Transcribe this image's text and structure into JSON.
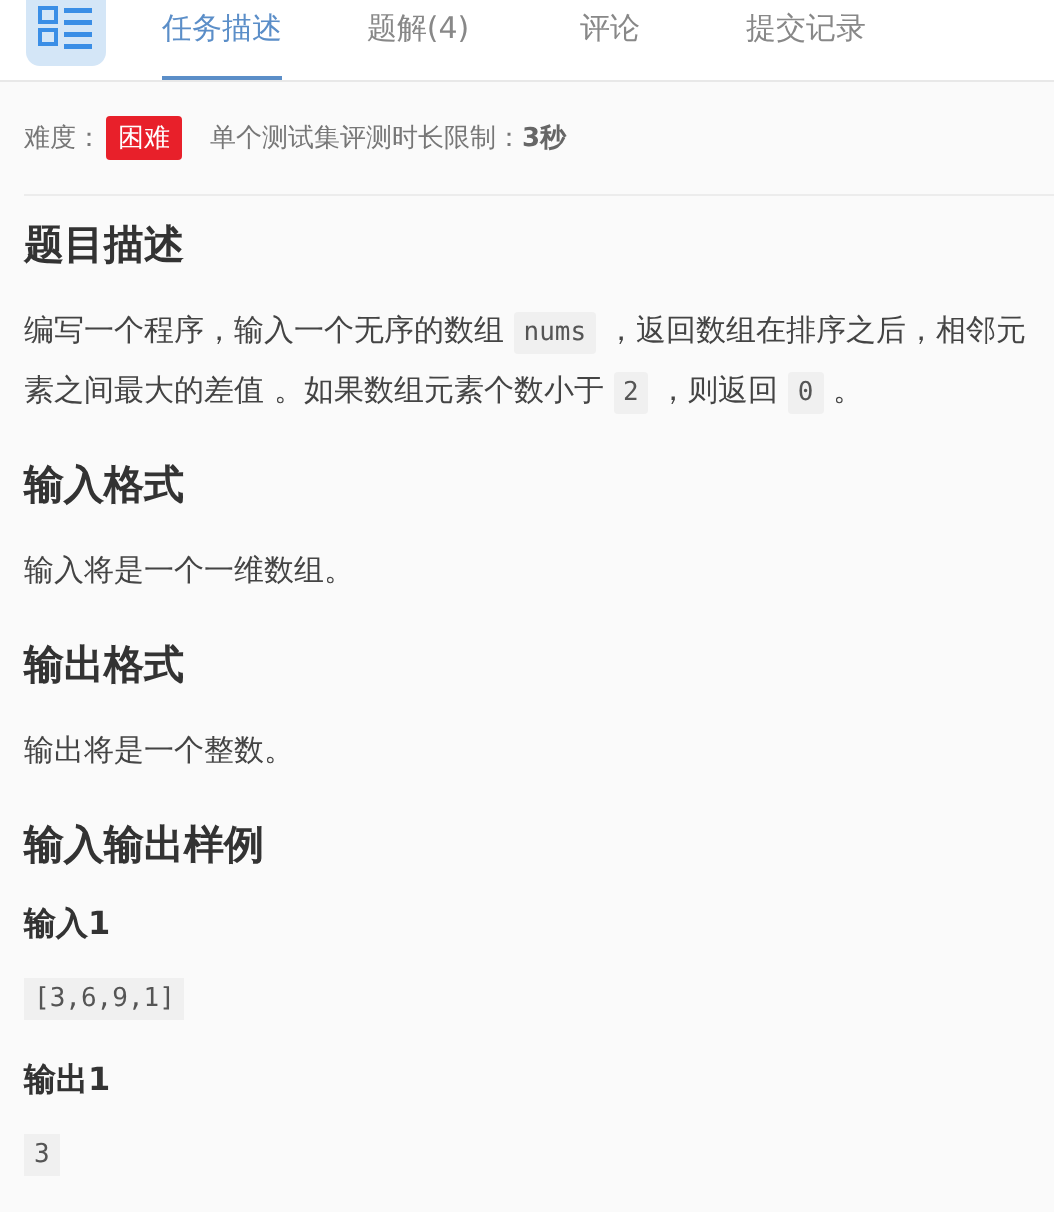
{
  "tabs": [
    {
      "label": "任务描述",
      "selected": true
    },
    {
      "label": "题解(4)",
      "selected": false
    },
    {
      "label": "评论",
      "selected": false
    },
    {
      "label": "提交记录",
      "selected": false
    }
  ],
  "info": {
    "difficulty_label": "难度：",
    "difficulty": "困难",
    "time_limit_label": "单个测试集评测时长限制：",
    "time_limit": "3秒"
  },
  "content": [
    {
      "kind": "heading",
      "text": "题目描述"
    },
    {
      "kind": "paragraph",
      "parts": [
        {
          "kind": "text",
          "text": "编写一个程序，输入一个无序的数组 "
        },
        {
          "kind": "code",
          "text": "nums"
        },
        {
          "kind": "text",
          "text": " ，返回数组在排序之后，相邻元素之间最大的差值 。如果数组元素个数小于 "
        },
        {
          "kind": "code",
          "text": "2"
        },
        {
          "kind": "text",
          "text": " ，则返回 "
        },
        {
          "kind": "code",
          "text": "0"
        },
        {
          "kind": "text",
          "text": " 。"
        }
      ]
    },
    {
      "kind": "heading",
      "text": "输入格式"
    },
    {
      "kind": "paragraph",
      "parts": [
        {
          "kind": "text",
          "text": "输入将是一个一维数组。"
        }
      ]
    },
    {
      "kind": "heading",
      "text": "输出格式"
    },
    {
      "kind": "paragraph",
      "parts": [
        {
          "kind": "text",
          "text": "输出将是一个整数。"
        }
      ]
    },
    {
      "kind": "heading",
      "text": "输入输出样例"
    },
    {
      "kind": "subheading",
      "text": "输入1"
    },
    {
      "kind": "code",
      "text": "[3,6,9,1]"
    },
    {
      "kind": "subheading",
      "text": "输出1"
    },
    {
      "kind": "code",
      "text": "3"
    }
  ]
}
